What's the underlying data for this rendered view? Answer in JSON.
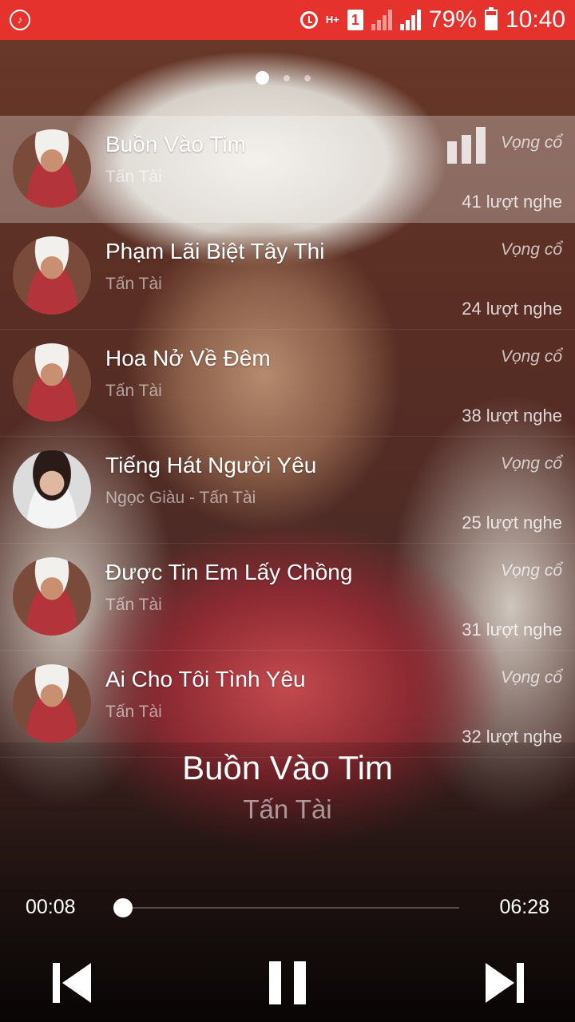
{
  "status_bar": {
    "app_icon": "app-logo-icon",
    "battery": "79%",
    "battery_level": 0.79,
    "time": "10:40",
    "sim_slot": "1",
    "network": "H+",
    "color": "#e5322d"
  },
  "pager": {
    "pages": 3,
    "current": 1
  },
  "playlist": [
    {
      "title": "Buồn Vào Tim",
      "artist": "Tấn Tài",
      "genre": "Vọng cổ",
      "plays": "41 lượt nghe",
      "playing": true
    },
    {
      "title": "Phạm Lãi Biệt Tây Thi",
      "artist": "Tấn Tài",
      "genre": "Vọng cổ",
      "plays": "24 lượt nghe",
      "playing": false
    },
    {
      "title": "Hoa Nở Về Đêm",
      "artist": "Tấn Tài",
      "genre": "Vọng cổ",
      "plays": "38 lượt nghe",
      "playing": false
    },
    {
      "title": "Tiếng Hát Người Yêu",
      "artist": "Ngọc Giàu - Tấn Tài",
      "genre": "Vọng cổ",
      "plays": "25 lượt nghe",
      "playing": false
    },
    {
      "title": "Được Tin Em Lấy Chồng",
      "artist": "Tấn Tài",
      "genre": "Vọng cổ",
      "plays": "31 lượt nghe",
      "playing": false
    },
    {
      "title": "Ai Cho Tôi Tình Yêu",
      "artist": "Tấn Tài",
      "genre": "Vọng cổ",
      "plays": "32 lượt nghe",
      "playing": false
    }
  ],
  "now_playing": {
    "title": "Buồn Vào Tim",
    "artist": "Tấn Tài",
    "current_time": "00:08",
    "total_time": "06:28",
    "progress": 0.02
  },
  "controls": {
    "prev_icon": "skip-previous-icon",
    "play_icon": "pause-icon",
    "next_icon": "skip-next-icon"
  }
}
